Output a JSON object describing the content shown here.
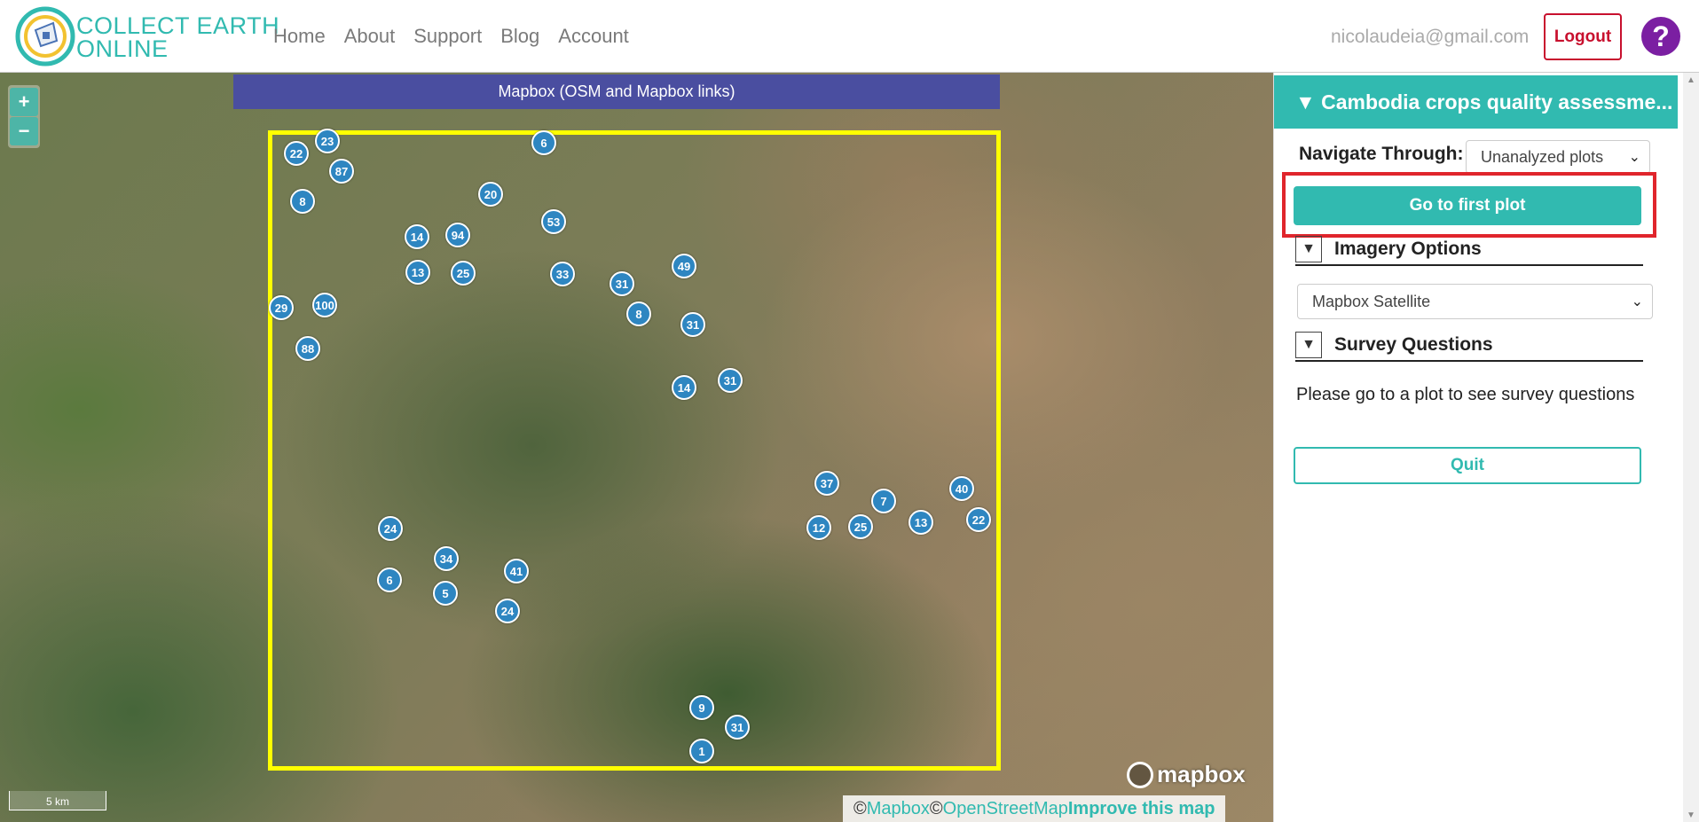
{
  "header": {
    "logo_line1": "COLLECT EARTH",
    "logo_line2": "ONLINE",
    "nav": [
      "Home",
      "About",
      "Support",
      "Blog",
      "Account"
    ],
    "user_email": "nicolaudeia@gmail.com",
    "logout_label": "Logout",
    "help_label": "?"
  },
  "map": {
    "zoom_in": "+",
    "zoom_out": "−",
    "imagery_banner": "Mapbox (OSM and Mapbox links)",
    "clusters": [
      "22",
      "23",
      "87",
      "8",
      "6",
      "20",
      "53",
      "14",
      "94",
      "13",
      "25",
      "33",
      "31",
      "49",
      "29",
      "100",
      "8",
      "31",
      "88",
      "14",
      "31",
      "37",
      "40",
      "7",
      "12",
      "25",
      "13",
      "22",
      "24",
      "34",
      "41",
      "6",
      "5",
      "24",
      "9",
      "31",
      "1"
    ],
    "mapbox_logo": "mapbox",
    "scale_label": "5 km",
    "attribution": {
      "copy1": "© ",
      "mapbox": "Mapbox",
      "copy2": "© ",
      "osm": "OpenStreetMap",
      "improve": "Improve this map"
    }
  },
  "panel": {
    "project_title": "▼ Cambodia crops quality assessme...",
    "navigate_label": "Navigate Through:",
    "navigate_value": "Unanalyzed plots",
    "first_plot_button": "Go to first plot",
    "imagery_section": "Imagery Options",
    "imagery_value": "Mapbox Satellite",
    "survey_section": "Survey Questions",
    "survey_message": "Please go to a plot to see survey questions",
    "quit_button": "Quit"
  },
  "colors": {
    "accent": "#31bab0",
    "logout": "#c8102e",
    "help": "#7b1fa2",
    "banner": "#4a4ea0",
    "bounds": "#ffff00",
    "cluster": "#2e86c1",
    "highlight": "#e0252c"
  }
}
